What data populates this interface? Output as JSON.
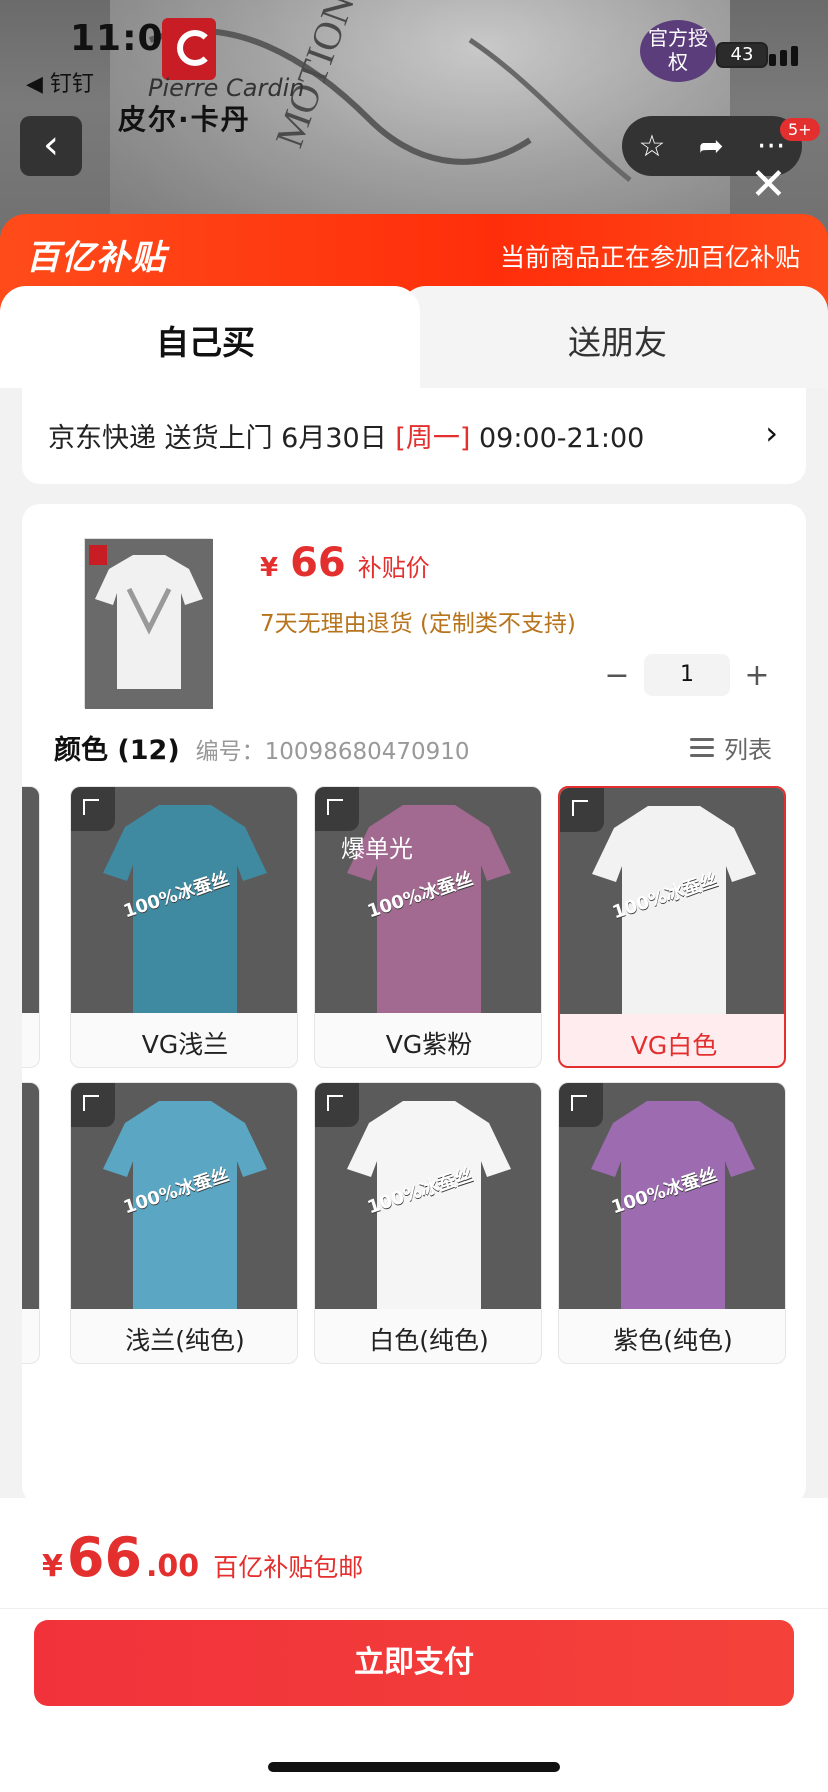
{
  "status_bar": {
    "time": "11:03",
    "back_app": "◀ 钉钉",
    "battery": "43"
  },
  "background": {
    "brand_name": "皮尔·卡丹",
    "signature": "Pierre Cardin",
    "official_badge": "官方授权",
    "message_count": "5+"
  },
  "promo": {
    "logo_text": "百亿补贴",
    "message": "当前商品正在参加百亿补贴"
  },
  "tabs": [
    {
      "label": "自己买",
      "active": true
    },
    {
      "label": "送朋友",
      "active": false
    }
  ],
  "delivery": {
    "prefix": "京东快递 送货上门 6月30日 ",
    "weekday": "[周一]",
    "time_range": " 09:00-21:00"
  },
  "product": {
    "price_symbol": "¥",
    "price": "66",
    "price_tag": "补贴价",
    "return_policy": "7天无理由退货 (定制类不支持)",
    "quantity": "1",
    "color_title": "颜色 (12)",
    "sku": "编号：10098680470910",
    "list_toggle": "列表",
    "watermark": "100%冰蚕丝",
    "overlay_text": "爆单光"
  },
  "colors": [
    {
      "label": "VG浅兰",
      "selected": false,
      "shirt": "#3f8aa0"
    },
    {
      "label": "VG紫粉",
      "selected": false,
      "shirt": "#a26a90"
    },
    {
      "label": "VG白色",
      "selected": true,
      "shirt": "#f2f2f2"
    },
    {
      "label": "浅兰(纯色)",
      "selected": false,
      "shirt": "#5aa6c3"
    },
    {
      "label": "白色(纯色)",
      "selected": false,
      "shirt": "#f5f5f5"
    },
    {
      "label": "紫色(纯色)",
      "selected": false,
      "shirt": "#9c6bb0"
    }
  ],
  "bottom": {
    "price_symbol": "¥",
    "price_int": "66",
    "price_dec": ".00",
    "price_note": "百亿补贴包邮",
    "pay_label": "立即支付"
  },
  "theme": {
    "accent": "#e3302e",
    "promo_orange": "#ff3d12",
    "return_color": "#b8741d"
  }
}
